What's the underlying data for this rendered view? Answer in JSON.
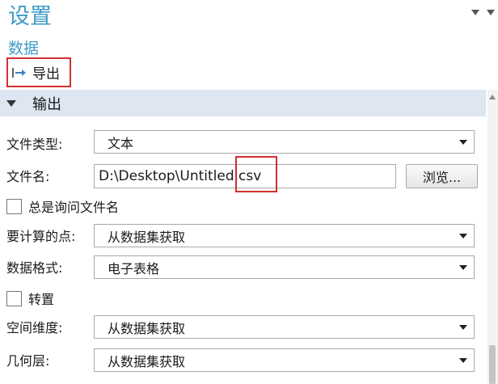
{
  "header": {
    "title": "设置",
    "subtitle": "数据"
  },
  "toolbar": {
    "export_label": "导出"
  },
  "section": {
    "label": "输出"
  },
  "form": {
    "file_type": {
      "label": "文件类型:",
      "value": "文本"
    },
    "file_name": {
      "label": "文件名:",
      "value": "D:\\Desktop\\Untitled.csv",
      "browse_label": "浏览..."
    },
    "always_ask": {
      "label": "总是询问文件名",
      "checked": false
    },
    "points": {
      "label": "要计算的点:",
      "value": "从数据集获取"
    },
    "data_format": {
      "label": "数据格式:",
      "value": "电子表格"
    },
    "transpose": {
      "label": "转置",
      "checked": false
    },
    "space_dim": {
      "label": "空间维度:",
      "value": "从数据集获取"
    },
    "geom_level": {
      "label": "几何层:",
      "value": "从数据集获取"
    }
  },
  "colors": {
    "title": "#3f9bc7",
    "section_bg": "#dde6f1",
    "highlight": "#d32f2f"
  },
  "icons": {
    "export": "export-arrow-icon",
    "section_toggle": "collapse-triangle-icon",
    "dropdown": "chevron-down-icon"
  }
}
